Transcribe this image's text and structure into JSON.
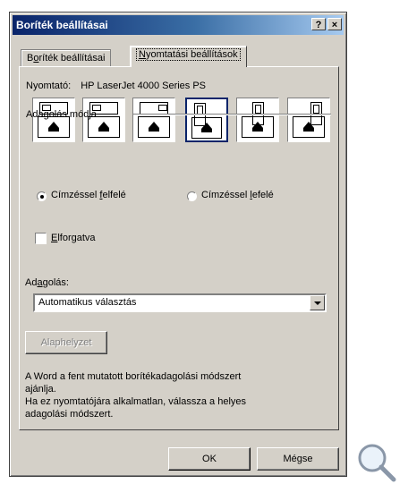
{
  "window": {
    "title": "Boríték beállításai",
    "help_label": "?",
    "close_label": "×"
  },
  "tabs": [
    {
      "label_pre": "B",
      "label_u": "o",
      "label_post": "ríték beállításai",
      "active": false
    },
    {
      "label_pre": "",
      "label_u": "N",
      "label_post": "yomtatási beállítások",
      "active": true
    }
  ],
  "printer": {
    "label": "Nyomtató:",
    "value": "HP LaserJet 4000 Series PS"
  },
  "feed_group": {
    "label": "Adagolás módja",
    "methods": [
      {
        "orientation": "horizontal",
        "position": "left"
      },
      {
        "orientation": "horizontal",
        "position": "center"
      },
      {
        "orientation": "horizontal",
        "position": "right"
      },
      {
        "orientation": "vertical",
        "position": "left",
        "selected": true
      },
      {
        "orientation": "vertical",
        "position": "center"
      },
      {
        "orientation": "vertical",
        "position": "right"
      }
    ],
    "face_up": {
      "pre": "Címzéssel ",
      "u": "f",
      "post": "elfelé",
      "checked": true
    },
    "face_down": {
      "pre": "Címzéssel ",
      "u": "l",
      "post": "efelé",
      "checked": false
    }
  },
  "rotate": {
    "pre": "",
    "u": "E",
    "post": "lforgatva",
    "checked": false
  },
  "source": {
    "label_pre": "Ad",
    "label_u": "a",
    "label_post": "golás:",
    "value": "Automatikus választás"
  },
  "reset_button": "Alaphelyzet",
  "info_lines": [
    "A Word a fent mutatott borítékadagolási módszert",
    "ajánlja.",
    "Ha ez nyomtatójára alkalmatlan, válassza a helyes",
    "adagolási módszert."
  ],
  "buttons": {
    "ok": "OK",
    "cancel": "Mégse"
  },
  "icons": {
    "magnifier": "magnifier-icon",
    "feed_arrow": "up-arrow-icon"
  }
}
